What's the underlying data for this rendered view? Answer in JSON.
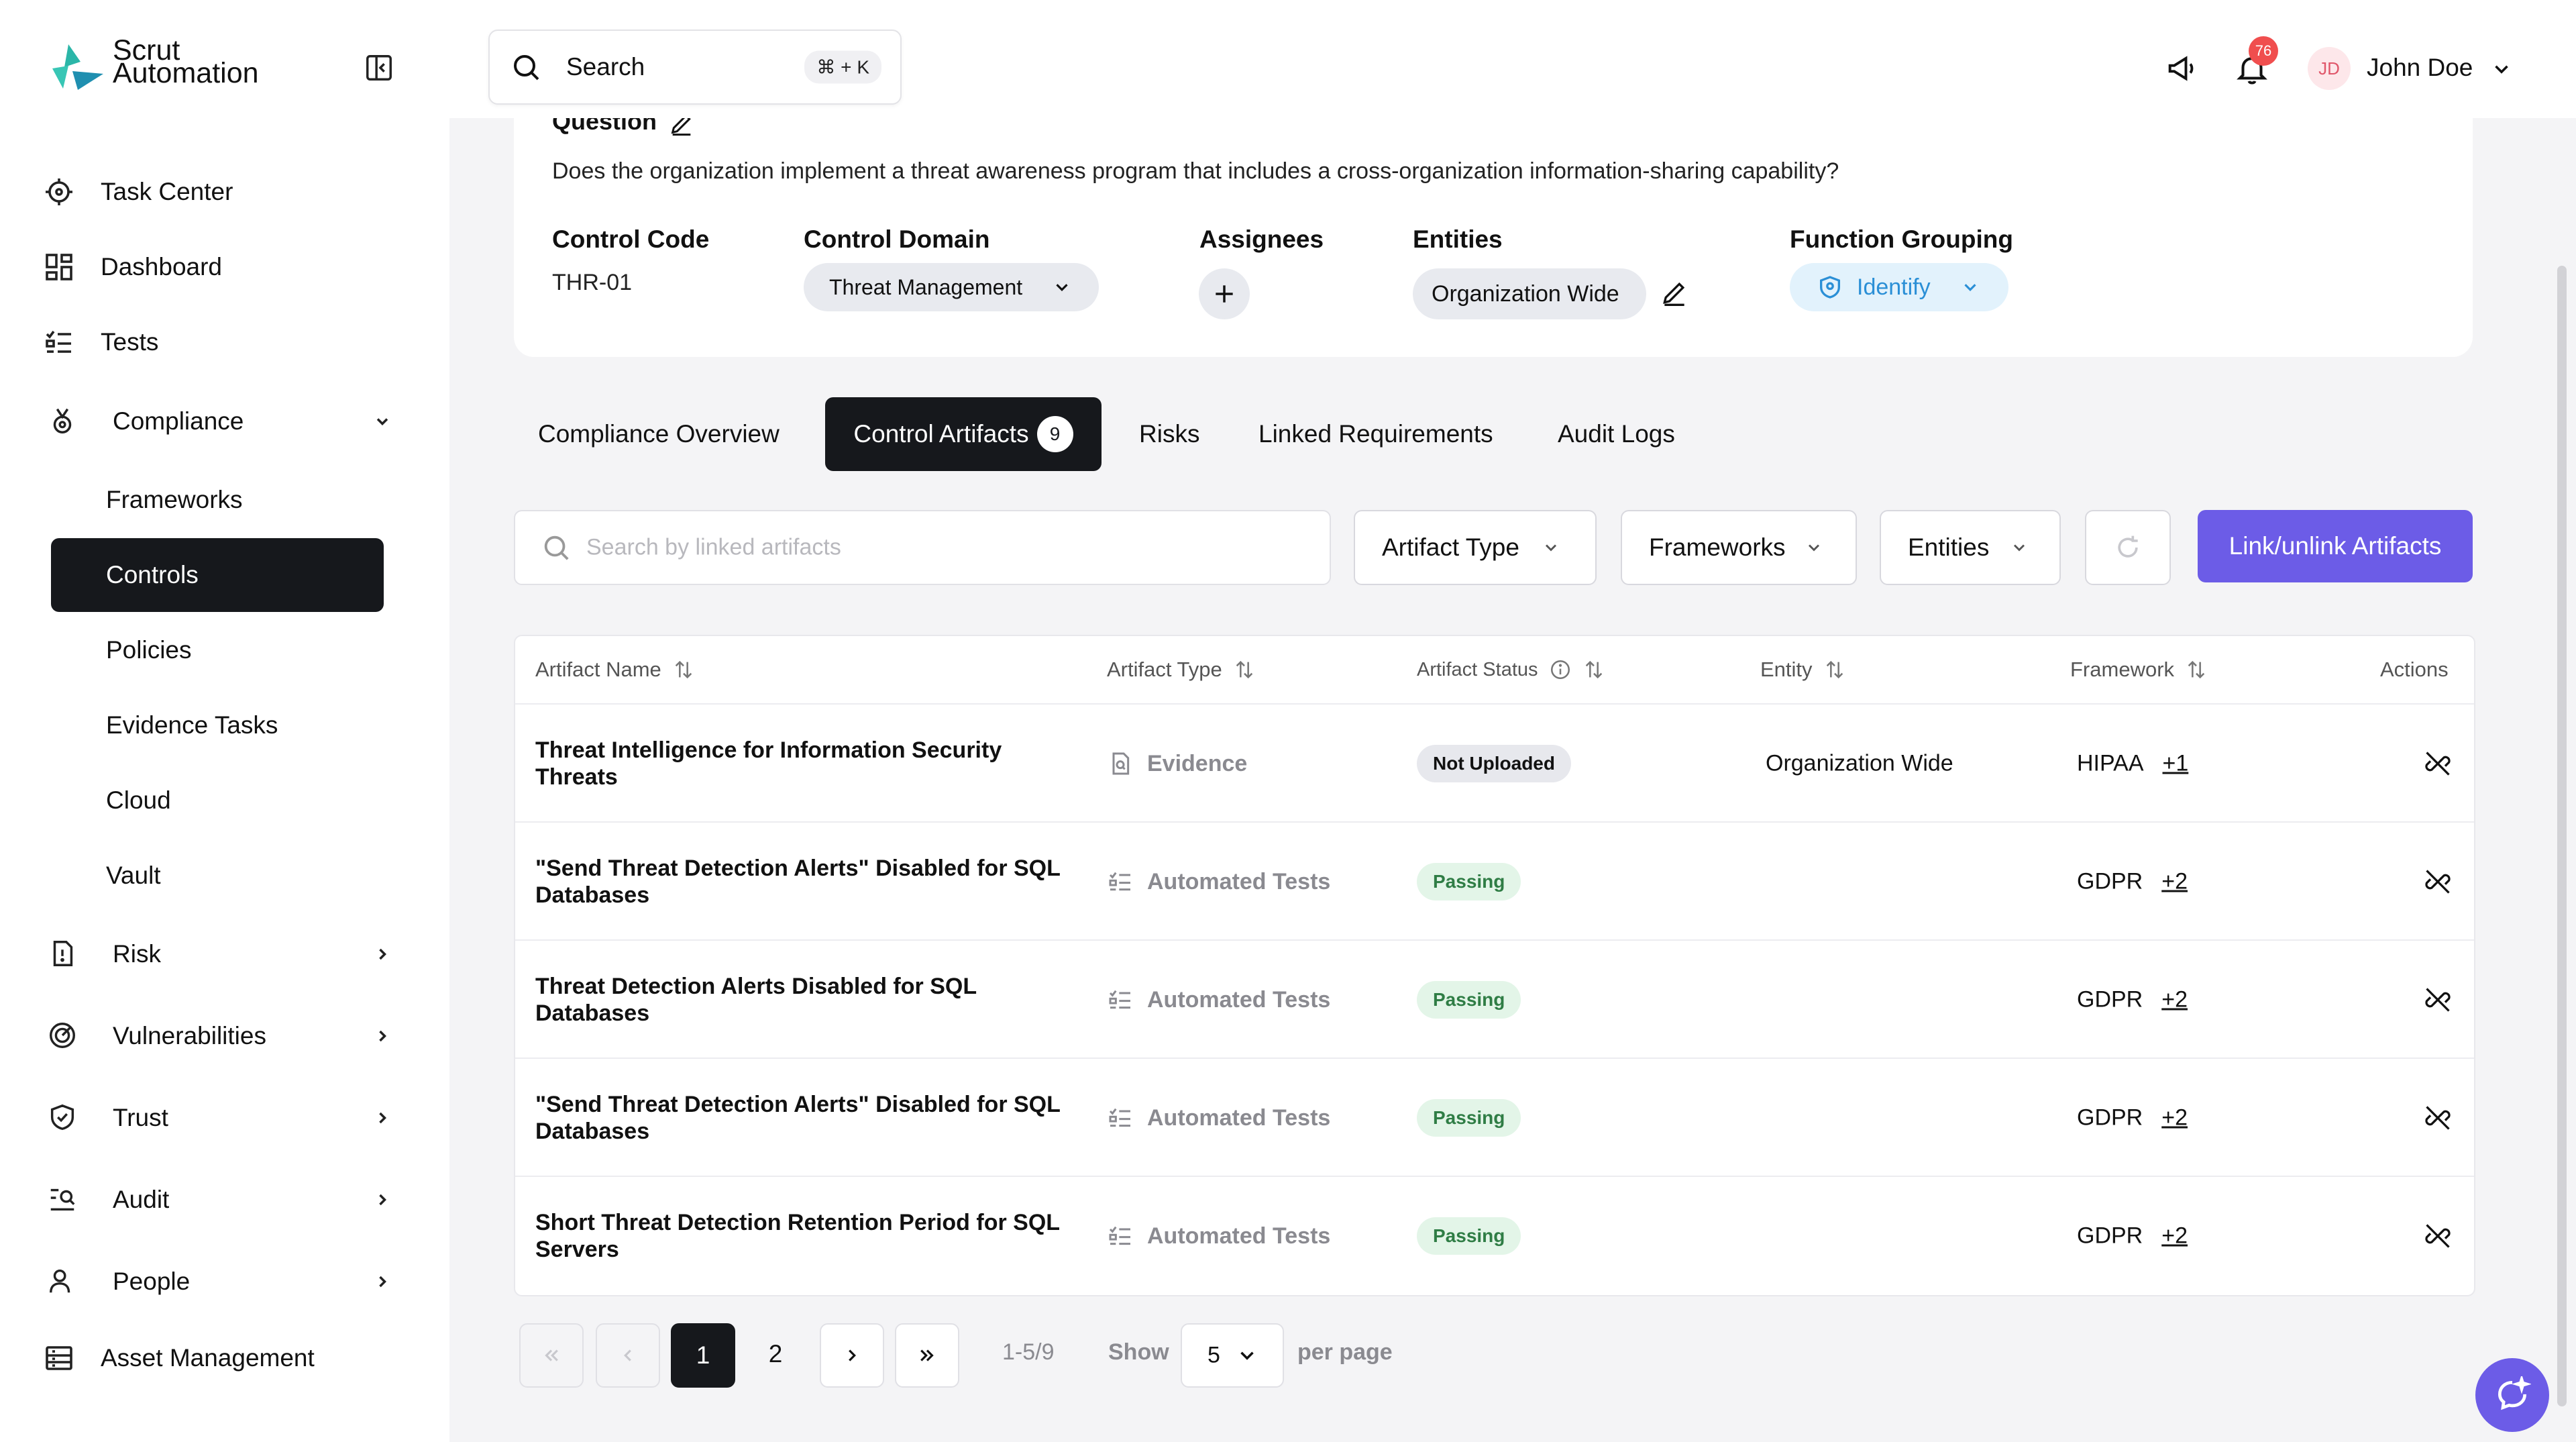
{
  "brand": {
    "line1": "Scrut",
    "line2": "Automation"
  },
  "nav": {
    "task_center": "Task Center",
    "dashboard": "Dashboard",
    "tests": "Tests",
    "compliance": "Compliance",
    "compliance_sub": [
      "Frameworks",
      "Controls",
      "Policies",
      "Evidence Tasks",
      "Cloud",
      "Vault"
    ],
    "risk": "Risk",
    "vulnerabilities": "Vulnerabilities",
    "trust": "Trust",
    "audit": "Audit",
    "people": "People",
    "asset_management": "Asset Management"
  },
  "header": {
    "search_label": "Search",
    "search_shortcut": "⌘ + K",
    "notification_count": "76",
    "user_initials": "JD",
    "user_name": "John Doe"
  },
  "control": {
    "question_label": "Question",
    "question_text": "Does the organization implement a threat awareness program that includes a cross-organization information-sharing capability?",
    "code_label": "Control Code",
    "code_value": "THR-01",
    "domain_label": "Control Domain",
    "domain_value": "Threat Management",
    "assignees_label": "Assignees",
    "entities_label": "Entities",
    "entities_value": "Organization Wide",
    "function_label": "Function Grouping",
    "function_value": "Identify"
  },
  "tabs": {
    "overview": "Compliance Overview",
    "artifacts": "Control Artifacts",
    "artifacts_count": "9",
    "risks": "Risks",
    "linked": "Linked Requirements",
    "audit_logs": "Audit Logs"
  },
  "filters": {
    "search_placeholder": "Search by linked artifacts",
    "artifact_type": "Artifact Type",
    "frameworks": "Frameworks",
    "entities": "Entities",
    "link_button": "Link/unlink Artifacts"
  },
  "table": {
    "headers": {
      "name": "Artifact Name",
      "type": "Artifact Type",
      "status": "Artifact Status",
      "entity": "Entity",
      "framework": "Framework",
      "actions": "Actions"
    },
    "rows": [
      {
        "name": "Threat Intelligence for Information Security Threats",
        "type": "Evidence",
        "type_icon": "evidence-icon",
        "status": "Not Uploaded",
        "entity": "Organization Wide",
        "framework": "HIPAA",
        "more": "+1"
      },
      {
        "name": "\"Send Threat Detection Alerts\" Disabled for SQL Databases",
        "type": "Automated Tests",
        "type_icon": "tests-icon",
        "status": "Passing",
        "entity": "",
        "framework": "GDPR",
        "more": "+2"
      },
      {
        "name": "Threat Detection Alerts Disabled for SQL Databases",
        "type": "Automated Tests",
        "type_icon": "tests-icon",
        "status": "Passing",
        "entity": "",
        "framework": "GDPR",
        "more": "+2"
      },
      {
        "name": "\"Send Threat Detection Alerts\" Disabled for SQL Databases",
        "type": "Automated Tests",
        "type_icon": "tests-icon",
        "status": "Passing",
        "entity": "",
        "framework": "GDPR",
        "more": "+2"
      },
      {
        "name": "Short Threat Detection Retention Period for SQL Servers",
        "type": "Automated Tests",
        "type_icon": "tests-icon",
        "status": "Passing",
        "entity": "",
        "framework": "GDPR",
        "more": "+2"
      }
    ]
  },
  "pagination": {
    "page1": "1",
    "page2": "2",
    "range": "1-5/9",
    "show_label": "Show",
    "per_page_value": "5",
    "per_page_label": "per page"
  },
  "colors": {
    "primary": "#6c5ce7",
    "dark": "#16181c",
    "passing_bg": "#e3f5e8",
    "passing_text": "#2f7d45",
    "identify": "#2a8fd6",
    "brand_teal": "#2bb6a8"
  }
}
